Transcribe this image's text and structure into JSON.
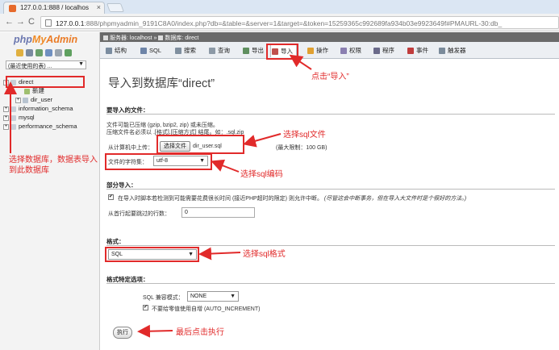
{
  "browser": {
    "tab_title": "127.0.0.1:888 / localhos",
    "tab_close": "×",
    "back": "←",
    "forward": "→",
    "reload": "C",
    "url_host": "127.0.0.1",
    "url_rest": ":888/phpmyadmin_9191C8A0/index.php?db=&table=&server=1&target=&token=15259365c992689fa934b03e9923649f#PMAURL-30:db_"
  },
  "sidebar": {
    "logo_php": "php",
    "logo_my": "My",
    "logo_admin": "Admin",
    "recent_label": "(最近使用的表) ...",
    "recent_arrow": "▼",
    "tree": [
      {
        "expander": "−",
        "label": "direct"
      },
      {
        "expander": "",
        "label": "新建"
      },
      {
        "expander": "+",
        "label": "dir_user"
      },
      {
        "expander": "+",
        "label": "information_schema"
      },
      {
        "expander": "+",
        "label": "mysql"
      },
      {
        "expander": "+",
        "label": "performance_schema"
      }
    ]
  },
  "breadcrumb": {
    "server": "服务器: localhost",
    "sep": "»",
    "db": "数据库: direct"
  },
  "tabs": [
    {
      "label": "结构",
      "color": "#7a8ca0"
    },
    {
      "label": "SQL",
      "color": "#6d84a8"
    },
    {
      "label": "搜索",
      "color": "#7f8f9f"
    },
    {
      "label": "查询",
      "color": "#8c99a6"
    },
    {
      "label": "导出",
      "color": "#5f8f5f"
    },
    {
      "label": "导入",
      "color": "#c0504d"
    },
    {
      "label": "操作",
      "color": "#e0a030"
    },
    {
      "label": "权限",
      "color": "#8a7fb0"
    },
    {
      "label": "程序",
      "color": "#6a6a8a"
    },
    {
      "label": "事件",
      "color": "#c03c3c"
    },
    {
      "label": "触发器",
      "color": "#7a8a9a"
    }
  ],
  "page": {
    "title": "导入到数据库“direct”",
    "file_section": "要导入的文件：",
    "compress_line1": "文件可能已压缩 (gzip, bzip2, zip) 或未压缩。",
    "compress_line2": "压缩文件名必须以 .[格式].[压缩方式] 结尾。如：.sql.zip",
    "upload_label": "从计算机中上传：",
    "choose_file": "选择文件",
    "file_name": "dir_user.sql",
    "max_limit": "(最大限制：100 GB)",
    "charset_label": "文件的字符集：",
    "charset_value": "utf-8",
    "partial_section": "部分导入：",
    "partial_check": "在导入时脚本若检测到可能需要花费很长时间 (接近PHP超时的限定) 则允许中断。",
    "partial_note": "(尽管这会中断事务，但在导入大文件时是个很好的方法。)",
    "skip_label": "从首行起要跳过的行数：",
    "skip_value": "0",
    "format_section": "格式：",
    "format_value": "SQL",
    "format_opts_section": "格式特定选项：",
    "compat_label": "SQL 兼容模式：",
    "compat_value": "NONE",
    "auto_inc": "不要给零值使用自增 (AUTO_INCREMENT)",
    "execute": "执行",
    "dropdown_arrow": "▼",
    "check_mark": "✔"
  },
  "annotations": {
    "click_import": "点击“导入”",
    "select_db": "选择数据库，数据表导入到此数据库",
    "select_file": "选择sql文件",
    "select_charset": "选择sql编码",
    "select_format": "选择sql格式",
    "click_execute": "最后点击执行"
  },
  "colors": {
    "annotation": "#e12a2a",
    "breadcrumb_bg": "#6a6a6a"
  }
}
